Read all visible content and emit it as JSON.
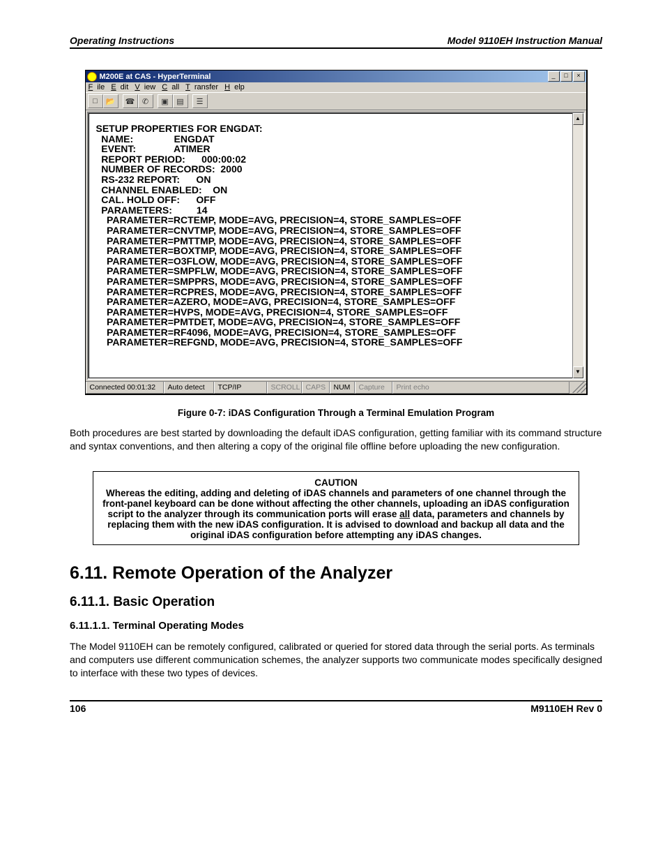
{
  "header": {
    "left": "Operating Instructions",
    "right": "Model 9110EH Instruction Manual"
  },
  "footer": {
    "page": "106",
    "rev": "M9110EH Rev 0"
  },
  "hyperterm": {
    "title": "M200E  at CAS - HyperTerminal",
    "menu": {
      "file": "File",
      "edit": "Edit",
      "view": "View",
      "call": "Call",
      "transfer": "Transfer",
      "help": "Help"
    },
    "status": {
      "conn": "Connected 00:01:32",
      "detect": "Auto detect",
      "proto": "TCP/IP",
      "scroll": "SCROLL",
      "caps": "CAPS",
      "num": "NUM",
      "capture": "Capture",
      "echo": "Print echo"
    },
    "terminal": "SETUP PROPERTIES FOR ENGDAT:\n  NAME:               ENGDAT\n  EVENT:              ATIMER\n  REPORT PERIOD:      000:00:02\n  NUMBER OF RECORDS:  2000\n  RS-232 REPORT:      ON\n  CHANNEL ENABLED:    ON\n  CAL. HOLD OFF:      OFF\n  PARAMETERS:         14\n    PARAMETER=RCTEMP, MODE=AVG, PRECISION=4, STORE_SAMPLES=OFF\n    PARAMETER=CNVTMP, MODE=AVG, PRECISION=4, STORE_SAMPLES=OFF\n    PARAMETER=PMTTMP, MODE=AVG, PRECISION=4, STORE_SAMPLES=OFF\n    PARAMETER=BOXTMP, MODE=AVG, PRECISION=4, STORE_SAMPLES=OFF\n    PARAMETER=O3FLOW, MODE=AVG, PRECISION=4, STORE_SAMPLES=OFF\n    PARAMETER=SMPFLW, MODE=AVG, PRECISION=4, STORE_SAMPLES=OFF\n    PARAMETER=SMPPRS, MODE=AVG, PRECISION=4, STORE_SAMPLES=OFF\n    PARAMETER=RCPRES, MODE=AVG, PRECISION=4, STORE_SAMPLES=OFF\n    PARAMETER=AZERO, MODE=AVG, PRECISION=4, STORE_SAMPLES=OFF\n    PARAMETER=HVPS, MODE=AVG, PRECISION=4, STORE_SAMPLES=OFF\n    PARAMETER=PMTDET, MODE=AVG, PRECISION=4, STORE_SAMPLES=OFF\n    PARAMETER=RF4096, MODE=AVG, PRECISION=4, STORE_SAMPLES=OFF\n    PARAMETER=REFGND, MODE=AVG, PRECISION=4, STORE_SAMPLES=OFF"
  },
  "figcap": "Figure 0-7:   iDAS Configuration Through a Terminal Emulation Program",
  "para1": "Both procedures are best started by downloading the default iDAS configuration, getting familiar with its command structure and syntax conventions, and then altering a copy of the original file offline before uploading the new configuration.",
  "caution": {
    "title": "CAUTION",
    "p1a": "Whereas the editing, adding and deleting of iDAS channels and parameters of one channel through the front-panel keyboard can be done without affecting the other channels, uploading an iDAS configuration script to the analyzer through its communication ports will erase ",
    "all": "all",
    "p1b": " data, parameters and channels by replacing them with the new iDAS configuration. It is advised to download and backup all data and the original iDAS configuration before attempting any iDAS changes."
  },
  "h2": "6.11. Remote Operation of the Analyzer",
  "h3": "6.11.1. Basic Operation",
  "h4": "6.11.1.1. Terminal Operating Modes",
  "para2": "The Model 9110EH can be remotely configured, calibrated or queried for stored data through the serial ports. As terminals and computers use different communication schemes, the analyzer supports two communicate modes specifically designed to interface with these two types of devices."
}
